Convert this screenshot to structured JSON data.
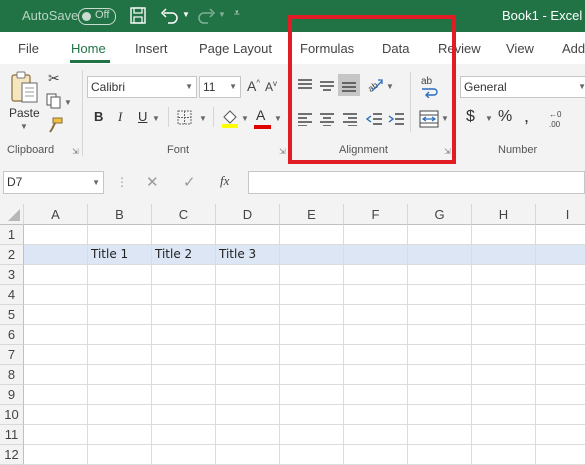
{
  "titlebar": {
    "autosave_label": "AutoSave",
    "autosave_state": "Off",
    "document_title": "Book1  -  Excel",
    "icons": [
      "save-icon",
      "undo-icon",
      "redo-icon",
      "customize-qat-icon"
    ],
    "background_color": "#217346"
  },
  "tabs": [
    "File",
    "Home",
    "Insert",
    "Page Layout",
    "Formulas",
    "Data",
    "Review",
    "View",
    "Add"
  ],
  "active_tab": "Home",
  "ribbon": {
    "clipboard": {
      "paste_label": "Paste",
      "group_label": "Clipboard"
    },
    "font": {
      "font_name": "Calibri",
      "font_size": "11",
      "bold": "B",
      "italic": "I",
      "underline": "U",
      "increase_size": "A",
      "decrease_size": "A",
      "font_color_glyph": "A",
      "group_label": "Font"
    },
    "alignment": {
      "group_label": "Alignment",
      "wrap_glyph": "ab"
    },
    "number": {
      "format": "General",
      "currency": "$",
      "percent": "%",
      "comma": ",",
      "group_label": "Number"
    }
  },
  "formula_bar": {
    "name_box": "D7",
    "fx": "fx",
    "value": ""
  },
  "grid": {
    "columns": [
      "A",
      "B",
      "C",
      "D",
      "E",
      "F",
      "G",
      "H",
      "I"
    ],
    "rows": [
      "1",
      "2",
      "3",
      "4",
      "5",
      "6",
      "7",
      "8",
      "9",
      "10",
      "11",
      "12"
    ],
    "cells": {
      "B2": "Title 1",
      "C2": "Title 2",
      "D2": "Title 3"
    },
    "highlighted_row_color": "#dce6f4"
  },
  "annotation": {
    "color": "#e21c24"
  }
}
